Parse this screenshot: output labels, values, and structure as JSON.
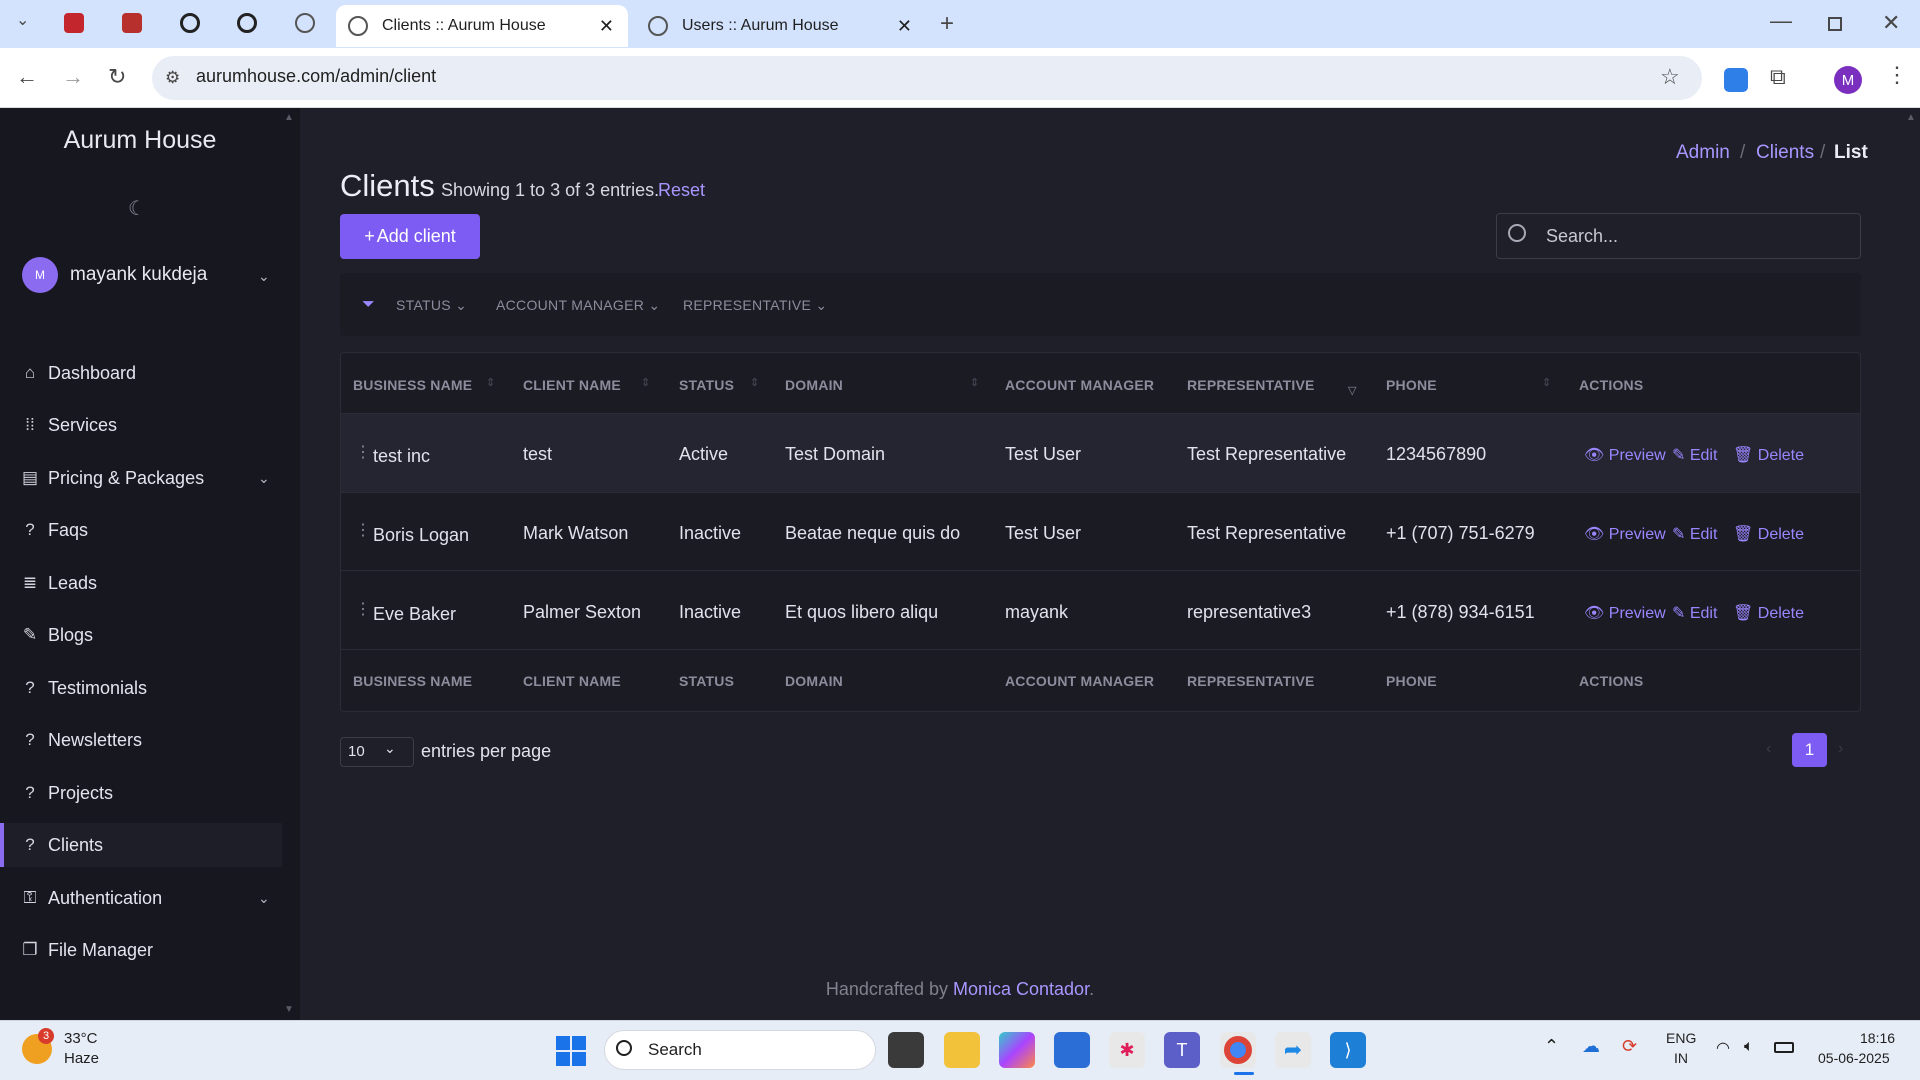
{
  "browser": {
    "tabs": [
      {
        "title": "Clients :: Aurum House",
        "active": true
      },
      {
        "title": "Users :: Aurum House",
        "active": false
      }
    ],
    "url": "aurumhouse.com/admin/client",
    "profile_initial": "M"
  },
  "sidebar": {
    "brand": "Aurum House",
    "user": {
      "initial": "M",
      "name": "mayank kukdeja"
    },
    "items": [
      {
        "label": "Dashboard",
        "icon": "home-icon"
      },
      {
        "label": "Services",
        "icon": "grid-dots-icon"
      },
      {
        "label": "Pricing & Packages",
        "icon": "wallet-icon",
        "has_submenu": true
      },
      {
        "label": "Faqs",
        "icon": "question-icon"
      },
      {
        "label": "Leads",
        "icon": "list-icon"
      },
      {
        "label": "Blogs",
        "icon": "blog-icon"
      },
      {
        "label": "Testimonials",
        "icon": "question-icon"
      },
      {
        "label": "Newsletters",
        "icon": "question-icon"
      },
      {
        "label": "Projects",
        "icon": "question-icon"
      },
      {
        "label": "Clients",
        "icon": "question-icon",
        "active": true
      },
      {
        "label": "Authentication",
        "icon": "lock-icon",
        "has_submenu": true
      },
      {
        "label": "File Manager",
        "icon": "files-icon"
      }
    ]
  },
  "breadcrumb": [
    "Admin",
    "Clients",
    "List"
  ],
  "page": {
    "title": "Clients",
    "showing": "Showing 1 to 3 of 3 entries.",
    "reset": "Reset",
    "add_button": "Add client",
    "search_placeholder": "Search..."
  },
  "filters": [
    "STATUS",
    "ACCOUNT MANAGER",
    "REPRESENTATIVE"
  ],
  "table": {
    "columns": [
      "BUSINESS NAME",
      "CLIENT NAME",
      "STATUS",
      "DOMAIN",
      "ACCOUNT MANAGER",
      "REPRESENTATIVE",
      "PHONE",
      "ACTIONS"
    ],
    "rows": [
      {
        "business": "test inc",
        "client": "test",
        "status": "Active",
        "domain": "Test Domain",
        "manager": "Test User",
        "rep": "Test Representative",
        "phone": "1234567890"
      },
      {
        "business": "Boris Logan",
        "client": "Mark Watson",
        "status": "Inactive",
        "domain": "Beatae neque quis do",
        "manager": "Test User",
        "rep": "Test Representative",
        "phone": "+1 (707) 751-6279"
      },
      {
        "business": "Eve Baker",
        "client": "Palmer Sexton",
        "status": "Inactive",
        "domain": "Et quos libero aliqu",
        "manager": "mayank",
        "rep": "representative3",
        "phone": "+1 (878) 934-6151"
      }
    ],
    "actions": {
      "preview": "Preview",
      "edit": "Edit",
      "delete": "Delete"
    }
  },
  "pagination": {
    "per_page": "10",
    "per_page_label": "entries per page",
    "current": "1"
  },
  "footer": {
    "prefix": "Handcrafted by",
    "author": "Monica Contador",
    "suffix": "."
  },
  "taskbar": {
    "weather": {
      "temp": "33°C",
      "cond": "Haze",
      "badge": "3"
    },
    "search": "Search",
    "lang": [
      "ENG",
      "IN"
    ],
    "time": "18:16",
    "date": "05-06-2025"
  },
  "colors": {
    "accent": "#7c5cf2",
    "link": "#a996ff",
    "sidebar_bg": "#17171f",
    "main_bg": "#1f1f29"
  }
}
